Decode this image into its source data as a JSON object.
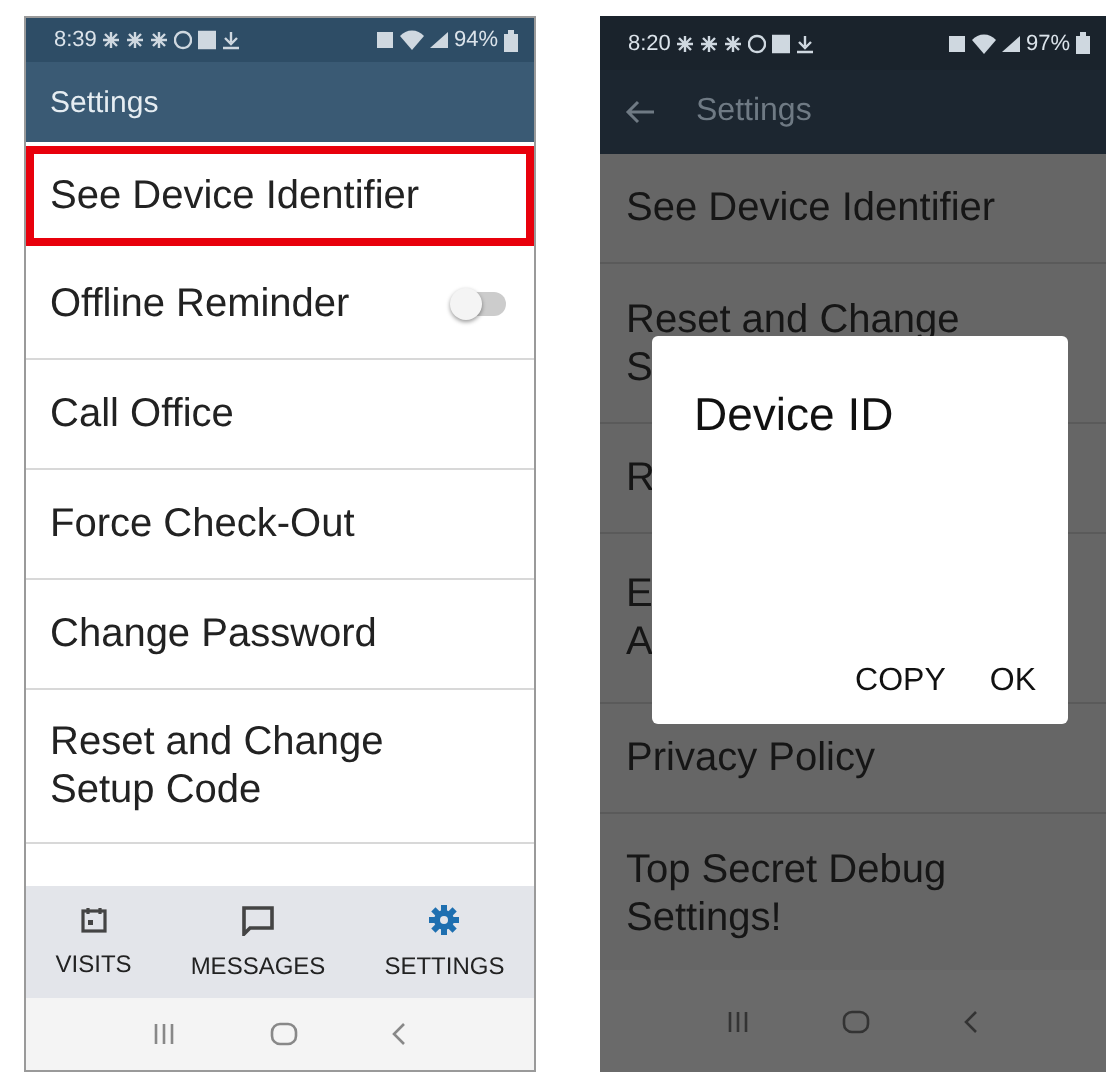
{
  "left_screen": {
    "status_bar": {
      "time": "8:39",
      "battery": "94%"
    },
    "app_bar": {
      "title": "Settings",
      "back": false
    },
    "items": [
      {
        "lines": [
          "See Device Identifier"
        ],
        "kind": "plain",
        "highlighted": true
      },
      {
        "lines": [
          "Offline Reminder"
        ],
        "kind": "toggle",
        "on": false,
        "highlighted": false
      },
      {
        "lines": [
          "Call Office"
        ],
        "kind": "plain",
        "highlighted": false
      },
      {
        "lines": [
          "Force Check-Out"
        ],
        "kind": "plain",
        "highlighted": false
      },
      {
        "lines": [
          "Change Password"
        ],
        "kind": "plain",
        "highlighted": false
      },
      {
        "lines": [
          "Reset and Change",
          "Setup Code"
        ],
        "kind": "plain",
        "highlighted": false
      }
    ],
    "bottom_nav": [
      {
        "label": "VISITS",
        "kind": "calendar",
        "selected": false
      },
      {
        "label": "MESSAGES",
        "kind": "chat",
        "selected": false
      },
      {
        "label": "SETTINGS",
        "kind": "gear",
        "selected": true
      }
    ]
  },
  "right_screen": {
    "status_bar": {
      "time": "8:20",
      "battery": "97%"
    },
    "app_bar": {
      "title": "Settings",
      "back": true
    },
    "items": [
      {
        "lines": [
          "See Device Identifier"
        ]
      },
      {
        "lines": [
          "Reset and Change",
          "S"
        ]
      },
      {
        "lines": [
          "R"
        ]
      },
      {
        "lines": [
          "E",
          "A"
        ]
      },
      {
        "lines": [
          "Privacy Policy"
        ]
      },
      {
        "lines": [
          "Top Secret Debug",
          "Settings!"
        ]
      }
    ],
    "dialog": {
      "title": "Device ID",
      "buttons": [
        "COPY",
        "OK"
      ]
    }
  }
}
